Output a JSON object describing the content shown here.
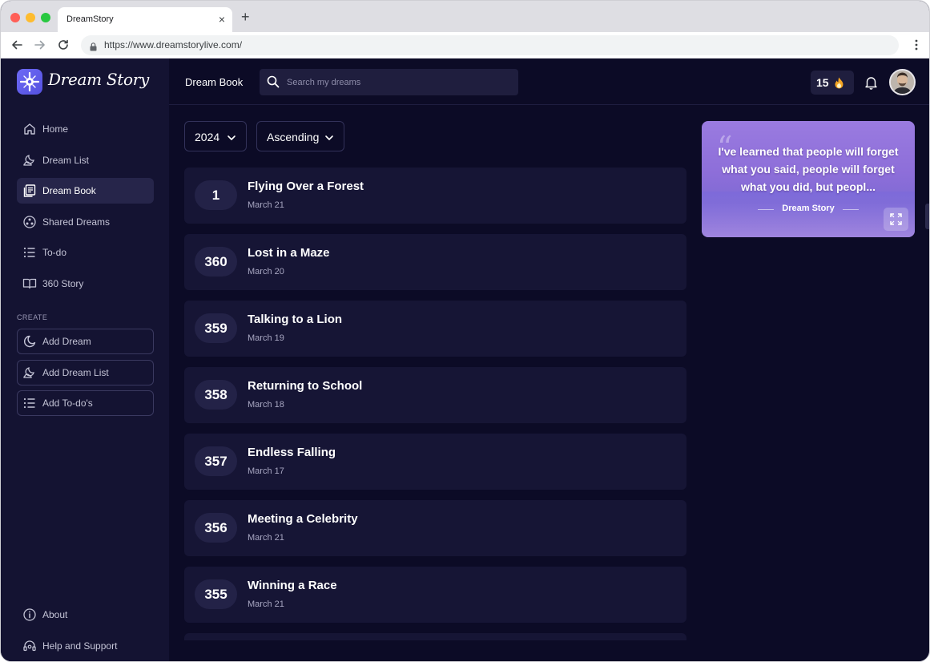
{
  "browser": {
    "tab_title": "DreamStory",
    "tab_close": "×",
    "new_tab": "+",
    "url": "https://www.dreamstorylive.com/"
  },
  "brand": {
    "name": "Dream Story"
  },
  "sidebar": {
    "nav": [
      {
        "label": "Home",
        "icon": "home-icon"
      },
      {
        "label": "Dream List",
        "icon": "moon-clouds-icon"
      },
      {
        "label": "Dream Book",
        "icon": "book-icon",
        "active": true
      },
      {
        "label": "Shared Dreams",
        "icon": "share-circle-icon"
      },
      {
        "label": "To-do",
        "icon": "list-icon"
      },
      {
        "label": "360 Story",
        "icon": "open-book-icon"
      }
    ],
    "create_label": "CREATE",
    "create": [
      {
        "label": "Add Dream",
        "icon": "moon-icon"
      },
      {
        "label": "Add Dream List",
        "icon": "moon-clouds-icon"
      },
      {
        "label": "Add To-do's",
        "icon": "list-icon"
      }
    ],
    "footer": [
      {
        "label": "About",
        "icon": "info-icon"
      },
      {
        "label": "Help and Support",
        "icon": "headset-icon"
      }
    ]
  },
  "header": {
    "title": "Dream Book",
    "search_placeholder": "Search my dreams",
    "streak": "15",
    "streak_icon": "flame-icon"
  },
  "filters": {
    "year": "2024",
    "order": "Ascending"
  },
  "dreams": [
    {
      "number": "1",
      "title": "Flying Over a Forest",
      "date": "March 21"
    },
    {
      "number": "360",
      "title": "Lost in a Maze",
      "date": "March 20"
    },
    {
      "number": "359",
      "title": "Talking to a Lion",
      "date": "March 19"
    },
    {
      "number": "358",
      "title": "Returning to School",
      "date": "March 18"
    },
    {
      "number": "357",
      "title": "Endless Falling",
      "date": "March 17"
    },
    {
      "number": "356",
      "title": "Meeting a Celebrity",
      "date": "March 21"
    },
    {
      "number": "355",
      "title": "Winning a Race",
      "date": "March 21"
    }
  ],
  "quote": {
    "text": "I've learned that people will forget what you said, people will forget what you did, but peopl...",
    "source": "Dream Story"
  },
  "colors": {
    "background": "#0c0b26",
    "sidebar": "#141332",
    "card": "#161535",
    "accent": "#6d6af5"
  }
}
